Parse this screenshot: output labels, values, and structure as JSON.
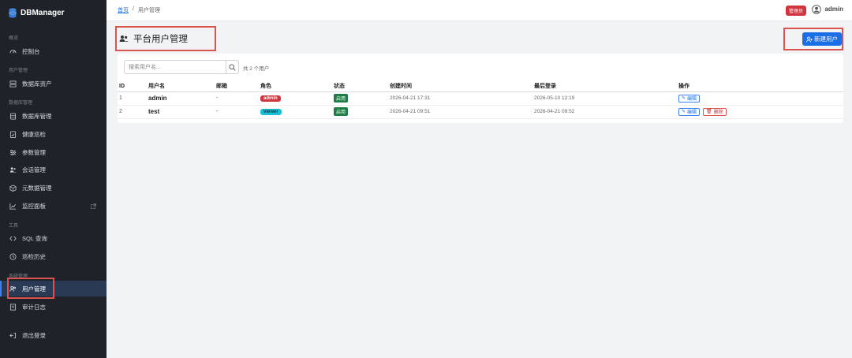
{
  "brand": {
    "name": "DBManager"
  },
  "sidebar": {
    "sections": [
      {
        "label": "概览"
      },
      {
        "label": "用户管理"
      },
      {
        "label": "数据库管理"
      },
      {
        "label": "工具"
      },
      {
        "label": "系统管理"
      }
    ],
    "items": [
      {
        "label": "控制台",
        "icon": "dashboard-icon"
      },
      {
        "label": "数据库资产",
        "icon": "server-icon"
      },
      {
        "label": "数据库管理",
        "icon": "database-icon"
      },
      {
        "label": "健康巡检",
        "icon": "clipboard-check-icon"
      },
      {
        "label": "参数管理",
        "icon": "sliders-icon"
      },
      {
        "label": "会话管理",
        "icon": "users-icon"
      },
      {
        "label": "元数据管理",
        "icon": "cube-icon"
      },
      {
        "label": "监控面板",
        "icon": "chart-line-icon"
      },
      {
        "label": "SQL 查询",
        "icon": "code-icon"
      },
      {
        "label": "巡检历史",
        "icon": "clock-history-icon"
      },
      {
        "label": "用户管理",
        "icon": "user-group-icon",
        "active": true
      },
      {
        "label": "审计日志",
        "icon": "journal-icon"
      },
      {
        "label": "退出登录",
        "icon": "logout-icon"
      }
    ]
  },
  "topbar": {
    "breadcrumb": {
      "home": "首页",
      "separator": "/",
      "current": "用户管理"
    },
    "role_badge": "管理员",
    "username": "admin"
  },
  "page": {
    "title": "平台用户管理",
    "new_user_label": "新建用户"
  },
  "search": {
    "placeholder": "搜索用户名...",
    "count_text": "共 2 个用户"
  },
  "table": {
    "columns": [
      "ID",
      "用户名",
      "邮箱",
      "角色",
      "状态",
      "创建时间",
      "最后登录",
      "操作"
    ],
    "rows": [
      {
        "id": "1",
        "username": "admin",
        "email": "-",
        "role": "admin",
        "status": "启用",
        "created": "2026-04-21 17:31",
        "last_login": "2026-05-10 12:19",
        "edit": "编辑",
        "delete": ""
      },
      {
        "id": "2",
        "username": "test",
        "email": "-",
        "role": "viewer",
        "status": "启用",
        "created": "2026-04-21 09:51",
        "last_login": "2026-04-21 09:52",
        "edit": "编辑",
        "delete": "删除"
      }
    ]
  },
  "colors": {
    "sidebar_bg": "#1f2329",
    "accent": "#1a6ee6",
    "danger": "#d0353e",
    "success": "#1e7d45",
    "viewer": "#1bc0d8"
  }
}
